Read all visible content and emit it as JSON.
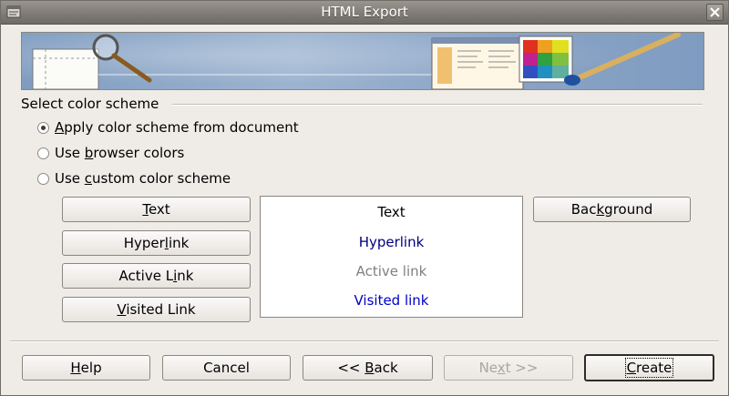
{
  "window": {
    "title": "HTML Export"
  },
  "group": {
    "label": "Select color scheme"
  },
  "options": [
    {
      "pre": "",
      "ul": "A",
      "post": "pply color scheme from document",
      "checked": true
    },
    {
      "pre": "Use ",
      "ul": "b",
      "post": "rowser colors",
      "checked": false
    },
    {
      "pre": "Use ",
      "ul": "c",
      "post": "ustom color scheme",
      "checked": false
    }
  ],
  "color_buttons": {
    "text": {
      "pre": "",
      "ul": "T",
      "post": "ext"
    },
    "hyperlink": {
      "pre": "Hyper",
      "ul": "l",
      "post": "ink"
    },
    "active_link": {
      "pre": "Active L",
      "ul": "i",
      "post": "nk"
    },
    "visited_link": {
      "pre": "",
      "ul": "V",
      "post": "isited Link"
    },
    "background": {
      "pre": "Bac",
      "ul": "k",
      "post": "ground"
    }
  },
  "preview": {
    "text": {
      "label": "Text",
      "color": "#000000"
    },
    "hyperlink": {
      "label": "Hyperlink",
      "color": "#000080"
    },
    "active_link": {
      "label": "Active link",
      "color": "#808080"
    },
    "visited_link": {
      "label": "Visited link",
      "color": "#0000cc"
    }
  },
  "footer": {
    "help": {
      "pre": "",
      "ul": "H",
      "post": "elp"
    },
    "cancel": {
      "label": "Cancel"
    },
    "back": {
      "pre": "<< ",
      "ul": "B",
      "post": "ack"
    },
    "next": {
      "pre": "Ne",
      "ul": "x",
      "post": "t >>"
    },
    "create": {
      "pre": "",
      "ul": "C",
      "post": "reate"
    }
  }
}
